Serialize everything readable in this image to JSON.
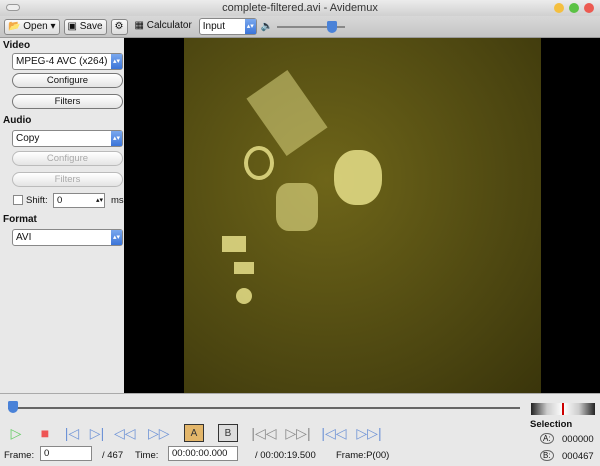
{
  "window": {
    "title": "complete-filtered.avi - Avidemux"
  },
  "toolbar": {
    "open": "Open",
    "save": "Save",
    "calculator": "Calculator",
    "input_select": "Input",
    "volume": 0.9
  },
  "video": {
    "label": "Video",
    "codec": "MPEG-4 AVC (x264)",
    "configure": "Configure",
    "filters": "Filters"
  },
  "audio": {
    "label": "Audio",
    "codec": "Copy",
    "configure": "Configure",
    "filters": "Filters",
    "shift_label": "Shift:",
    "shift_value": "0",
    "shift_unit": "ms"
  },
  "format": {
    "label": "Format",
    "value": "AVI"
  },
  "navigation": {
    "frame_label": "Frame:",
    "frame_value": "0",
    "total_frames": "/ 467",
    "time_label": "Time:",
    "time_value": "00:00:00.000",
    "duration": "/ 00:00:19.500",
    "frame_type": "Frame:P(00)",
    "position": 0
  },
  "selection": {
    "label": "Selection",
    "a_label": "A:",
    "a_value": "000000",
    "b_label": "B:",
    "b_value": "000467"
  }
}
